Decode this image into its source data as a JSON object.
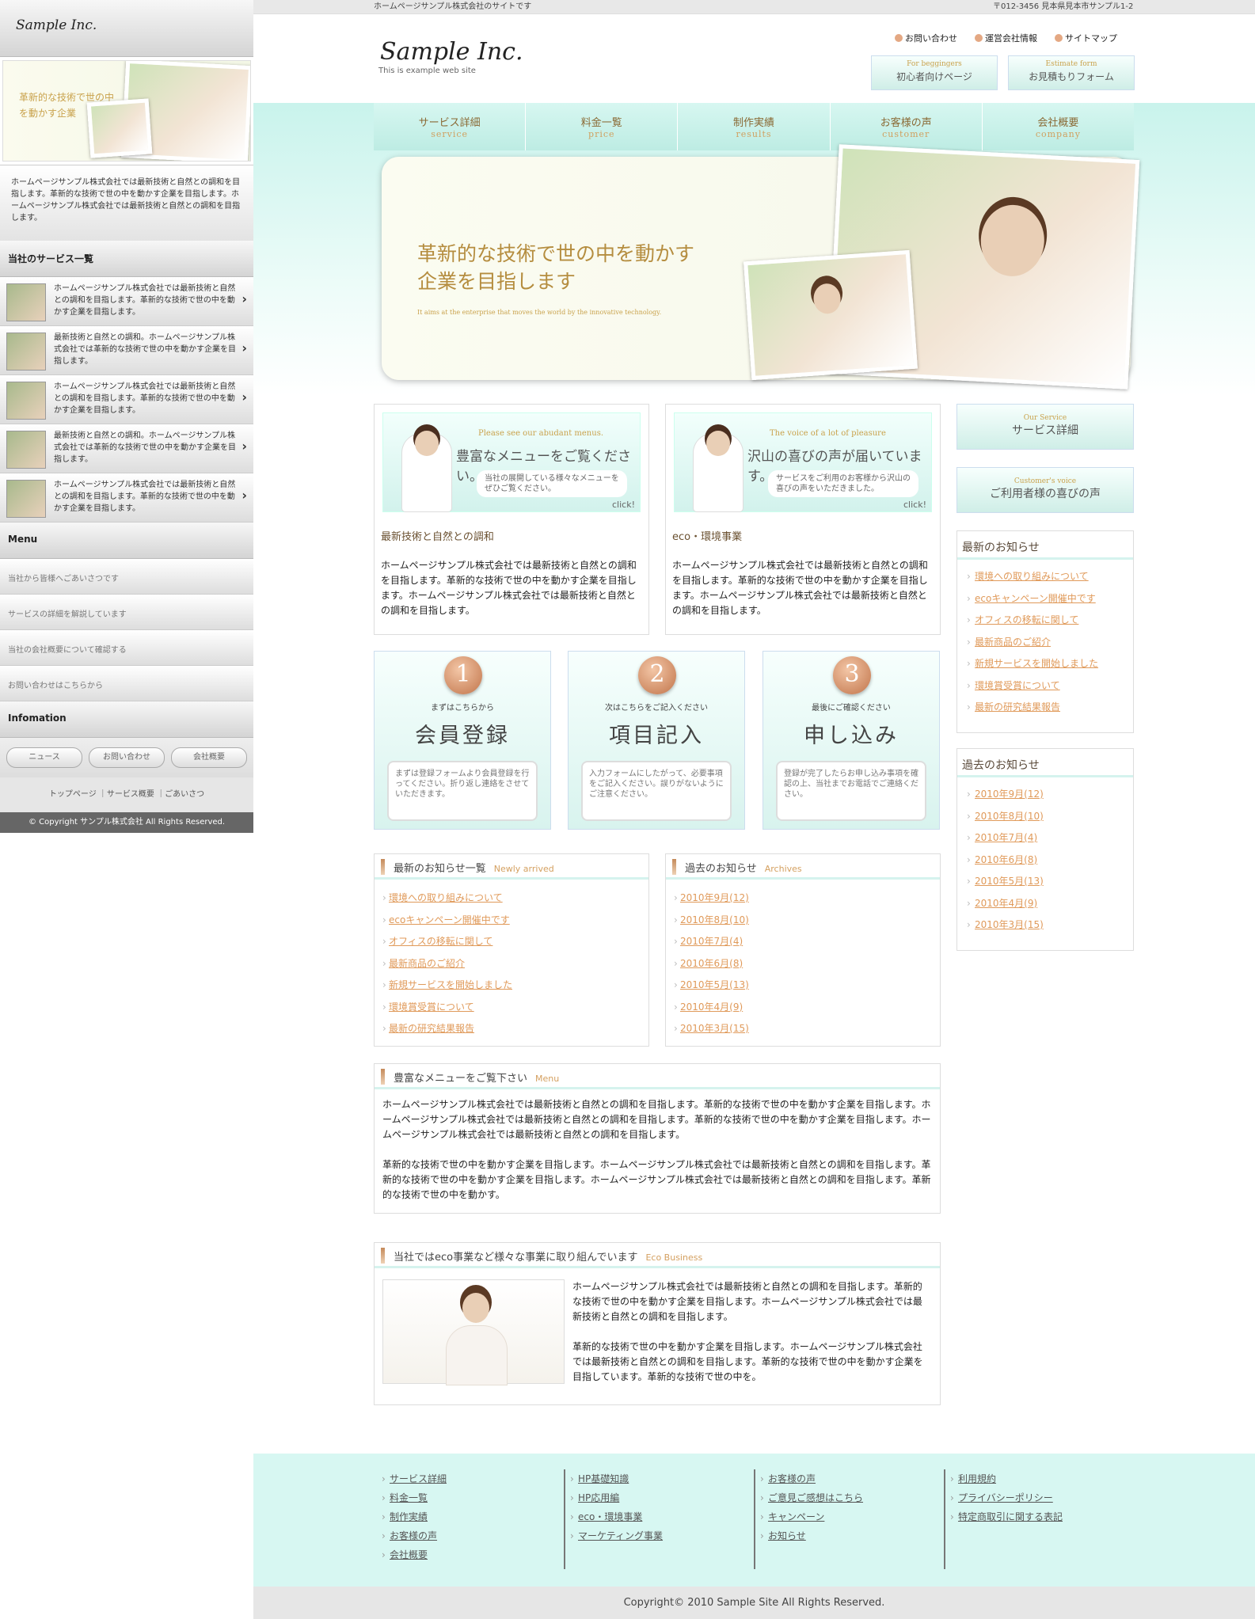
{
  "sidebar": {
    "logo": "Sample Inc.",
    "banner_text": "革新的な技術で世の中を動かす企業",
    "intro": "ホームページサンプル株式会社では最新技術と自然との調和を目指します。革新的な技術で世の中を動かす企業を目指します。ホームページサンプル株式会社では最新技術と自然との調和を目指します。",
    "services_heading": "当社のサービス一覧",
    "services": [
      "ホームページサンプル株式会社では最新技術と自然との調和を目指します。革新的な技術で世の中を動かす企業を目指します。",
      "最新技術と自然との調和。ホームページサンプル株式会社では革新的な技術で世の中を動かす企業を目指します。",
      "ホームページサンプル株式会社では最新技術と自然との調和を目指します。革新的な技術で世の中を動かす企業を目指します。",
      "最新技術と自然との調和。ホームページサンプル株式会社では革新的な技術で世の中を動かす企業を目指します。",
      "ホームページサンプル株式会社では最新技術と自然との調和を目指します。革新的な技術で世の中を動かす企業を目指します。"
    ],
    "menu_heading": "Menu",
    "menu": [
      "当社から皆様へごあいさつです",
      "サービスの詳細を解説しています",
      "当社の会社概要について確認する",
      "お問い合わせはこちらから"
    ],
    "info_heading": "Infomation",
    "info_buttons": [
      "ニュース",
      "お問い合わせ",
      "会社概要"
    ],
    "footer_links": "トップページ ｜サービス概要 ｜ごあいさつ",
    "copyright": "© Copyright サンプル株式会社 All Rights Reserved."
  },
  "topbar": {
    "tagline": "ホームページサンプル株式会社のサイトです",
    "address": "〒012-3456 見本県見本市サンプル1-2"
  },
  "header": {
    "logo": "Sample Inc.",
    "logo_sub": "This is example web site",
    "util": [
      "お問い合わせ",
      "運営会社情報",
      "サイトマップ"
    ],
    "btn1": {
      "en": "For beggingers",
      "jp": "初心者向けページ"
    },
    "btn2": {
      "en": "Estimate form",
      "jp": "お見積もりフォーム"
    }
  },
  "nav": [
    {
      "jp": "サービス詳細",
      "en": "service"
    },
    {
      "jp": "料金一覧",
      "en": "price"
    },
    {
      "jp": "制作実績",
      "en": "results"
    },
    {
      "jp": "お客様の声",
      "en": "customer"
    },
    {
      "jp": "会社概要",
      "en": "company"
    }
  ],
  "hero": {
    "headline": "革新的な技術で世の中を動かす企業を目指します",
    "sub": "It aims at the enterprise that moves the world by the innovative technology."
  },
  "promo1": {
    "en": "Please see our abudant menus.",
    "jp": "豊富なメニューをご覧ください。",
    "note": "当社の展開している様々なメニューをぜひご覧ください。",
    "click": "click!",
    "caption": "最新技術と自然との調和",
    "text": "ホームページサンプル株式会社では最新技術と自然との調和を目指します。革新的な技術で世の中を動かす企業を目指します。ホームページサンプル株式会社では最新技術と自然との調和を目指します。"
  },
  "promo2": {
    "en": "The voice of a lot of pleasure",
    "jp": "沢山の喜びの声が届いています。",
    "note": "サービスをご利用のお客様から沢山の喜びの声をいただきました。",
    "click": "click!",
    "caption": "eco・環境事業",
    "text": "ホームページサンプル株式会社では最新技術と自然との調和を目指します。革新的な技術で世の中を動かす企業を目指します。ホームページサンプル株式会社では最新技術と自然との調和を目指します。"
  },
  "steps": [
    {
      "num": "1",
      "lead": "まずはこちらから",
      "title": "会員登録",
      "desc": "まずは登録フォームより会員登録を行ってください。折り返し連絡をさせていただきます。"
    },
    {
      "num": "2",
      "lead": "次はこちらをご記入ください",
      "title": "項目記入",
      "desc": "入力フォームにしたがって、必要事項をご記入ください。誤りがないようにご注意ください。"
    },
    {
      "num": "3",
      "lead": "最後にご確認ください",
      "title": "申し込み",
      "desc": "登録が完了したらお申し込み事項を確認の上、当社までお電話でご連絡ください。"
    }
  ],
  "news": {
    "title": "最新のお知らせ一覧",
    "en": "Newly arrived",
    "items": [
      "環境への取り組みについて",
      "ecoキャンペーン開催中です",
      "オフィスの移転に関して",
      "最新商品のご紹介",
      "新規サービスを開始しました",
      "環境賞受賞について",
      "最新の研究結果報告"
    ]
  },
  "archives": {
    "title": "過去のお知らせ",
    "en": "Archives",
    "items": [
      "2010年9月(12)",
      "2010年8月(10)",
      "2010年7月(4)",
      "2010年6月(8)",
      "2010年5月(13)",
      "2010年4月(9)",
      "2010年3月(15)"
    ]
  },
  "menu_box": {
    "title": "豊富なメニューをご覧下さい",
    "en": "Menu",
    "p1": "ホームページサンプル株式会社では最新技術と自然との調和を目指します。革新的な技術で世の中を動かす企業を目指します。ホームページサンプル株式会社では最新技術と自然との調和を目指します。革新的な技術で世の中を動かす企業を目指します。ホームページサンプル株式会社では最新技術と自然との調和を目指します。",
    "p2": "革新的な技術で世の中を動かす企業を目指します。ホームページサンプル株式会社では最新技術と自然との調和を目指します。革新的な技術で世の中を動かす企業を目指します。ホームページサンプル株式会社では最新技術と自然との調和を目指します。革新的な技術で世の中を動かす。"
  },
  "eco_box": {
    "title": "当社ではeco事業など様々な事業に取り組んでいます",
    "en": "Eco Business",
    "p1": "ホームページサンプル株式会社では最新技術と自然との調和を目指します。革新的な技術で世の中を動かす企業を目指します。ホームページサンプル株式会社では最新技術と自然との調和を目指します。",
    "p2": "革新的な技術で世の中を動かす企業を目指します。ホームページサンプル株式会社では最新技術と自然との調和を目指します。革新的な技術で世の中を動かす企業を目指しています。革新的な技術で世の中を。"
  },
  "right": {
    "btn1": {
      "en": "Our Service",
      "jp": "サービス詳細"
    },
    "btn2": {
      "en": "Customer's voice",
      "jp": "ご利用者様の喜びの声"
    },
    "news_title": "最新のお知らせ",
    "archive_title": "過去のお知らせ"
  },
  "footer": {
    "col1": [
      "サービス詳細",
      "料金一覧",
      "制作実績",
      "お客様の声",
      "会社概要"
    ],
    "col2": [
      "HP基礎知識",
      "HP応用編",
      "eco・環境事業",
      "マーケティング事業"
    ],
    "col3": [
      "お客様の声",
      "ご意見ご感想はこちら",
      "キャンペーン",
      "お知らせ"
    ],
    "col4": [
      "利用規約",
      "プライバシーポリシー",
      "特定商取引に関する表記"
    ],
    "copyright": "Copyright© 2010 Sample Site All Rights Reserved."
  },
  "colors": {
    "accent": "#e09a5a",
    "mint": "#d7f7f2",
    "gold": "#b58d3f"
  }
}
